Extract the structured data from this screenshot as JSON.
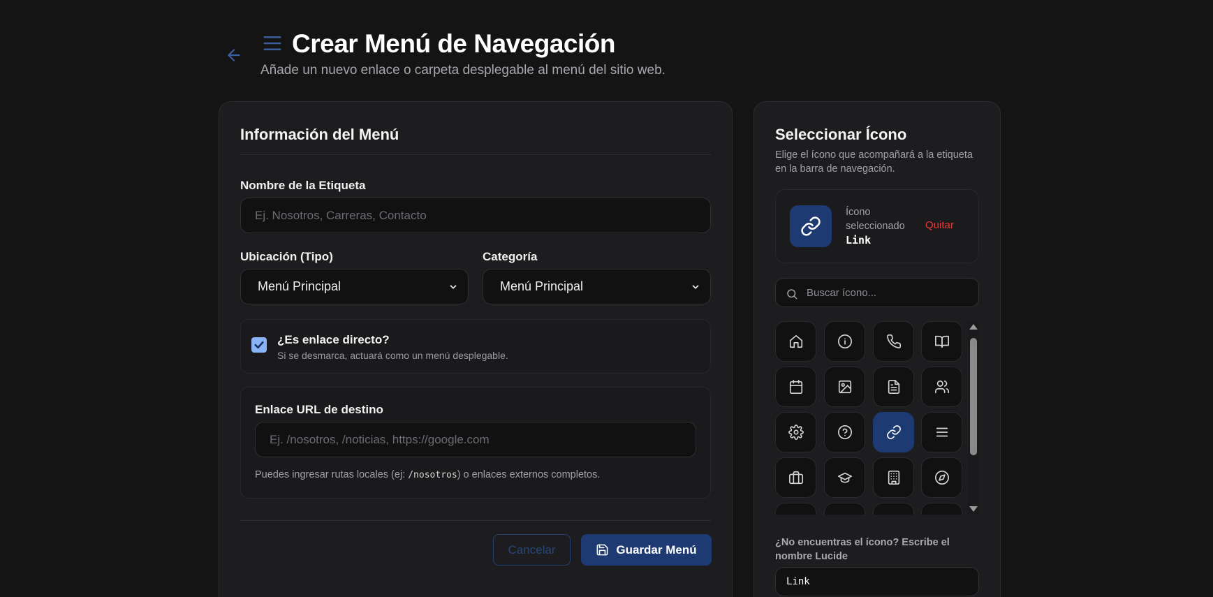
{
  "header": {
    "title": "Crear Menú de Navegación",
    "subtitle": "Añade un nuevo enlace o carpeta desplegable al menú del sitio web."
  },
  "form": {
    "section_title": "Información del Menú",
    "label_field": {
      "label": "Nombre de la Etiqueta",
      "placeholder": "Ej. Nosotros, Carreras, Contacto",
      "value": ""
    },
    "location": {
      "label": "Ubicación (Tipo)",
      "value": "Menú Principal"
    },
    "category": {
      "label": "Categoría",
      "value": "Menú Principal"
    },
    "direct_link": {
      "checked": true,
      "title": "¿Es enlace directo?",
      "subtitle": "Si se desmarca, actuará como un menú desplegable."
    },
    "url": {
      "label": "Enlace URL de destino",
      "placeholder": "Ej. /nosotros, /noticias, https://google.com",
      "value": "",
      "help_prefix": "Puedes ingresar rutas locales (ej: ",
      "help_code": "/nosotros",
      "help_suffix": ") o enlaces externos completos."
    },
    "cancel_label": "Cancelar",
    "save_label": "Guardar Menú"
  },
  "icon_picker": {
    "title": "Seleccionar Ícono",
    "description": "Elige el ícono que acompañará a la etiqueta en la barra de navegación.",
    "selected_label": "Ícono seleccionado",
    "selected_name": "Link",
    "remove_label": "Quitar",
    "search_placeholder": "Buscar ícono...",
    "icons": [
      "home",
      "info",
      "phone",
      "book-open",
      "calendar",
      "image",
      "file-text",
      "users",
      "settings",
      "help-circle",
      "link",
      "menu",
      "briefcase",
      "graduation-cap",
      "building",
      "compass",
      "more-1",
      "more-2",
      "more-3",
      "more-4"
    ],
    "active_icon": "link",
    "custom_label": "¿No encuentras el ícono? Escribe el nombre Lucide",
    "custom_value": "Link"
  },
  "colors": {
    "background": "#141414",
    "card": "#1d1d1f",
    "accent": "#1d3b72",
    "danger": "#e53a3a",
    "checkbox": "#8ab4f8"
  }
}
